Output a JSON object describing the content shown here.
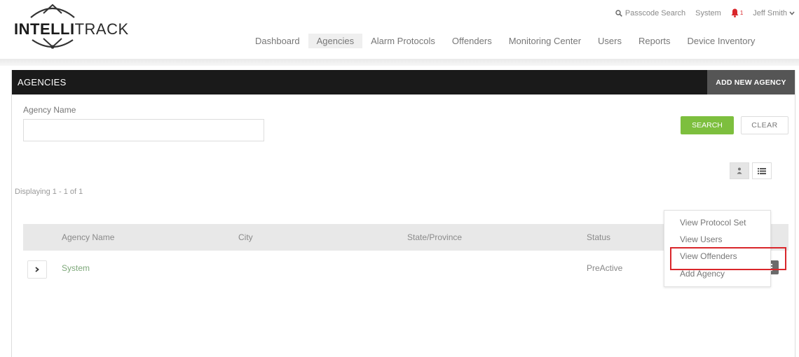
{
  "brand": {
    "logo_bold": "INTELLI",
    "logo_rest": "TRACK"
  },
  "utility": {
    "passcode_search": "Passcode Search",
    "system": "System",
    "notification_count": "1",
    "user": "Jeff Smith"
  },
  "nav": [
    {
      "label": "Dashboard",
      "active": false
    },
    {
      "label": "Agencies",
      "active": true
    },
    {
      "label": "Alarm Protocols",
      "active": false
    },
    {
      "label": "Offenders",
      "active": false
    },
    {
      "label": "Monitoring Center",
      "active": false
    },
    {
      "label": "Users",
      "active": false
    },
    {
      "label": "Reports",
      "active": false
    },
    {
      "label": "Device Inventory",
      "active": false
    }
  ],
  "panel": {
    "title": "AGENCIES",
    "add_button": "ADD NEW AGENCY",
    "field_label": "Agency Name",
    "field_value": "",
    "search_button": "SEARCH",
    "clear_button": "CLEAR",
    "displaying": "Displaying 1 - 1 of 1"
  },
  "table": {
    "headers": [
      "Agency Name",
      "City",
      "State/Province",
      "Status"
    ],
    "rows": [
      {
        "name": "System",
        "city": "",
        "state": "",
        "status": "PreActive"
      }
    ]
  },
  "row_menu": {
    "items": [
      "View Protocol Set",
      "View Users",
      "View Offenders",
      "Add Agency"
    ],
    "highlighted_item": "View Offenders"
  },
  "colors": {
    "accent_green": "#7dbf3e",
    "title_bar": "#1a1a1a",
    "alert_red": "#d9262b"
  }
}
